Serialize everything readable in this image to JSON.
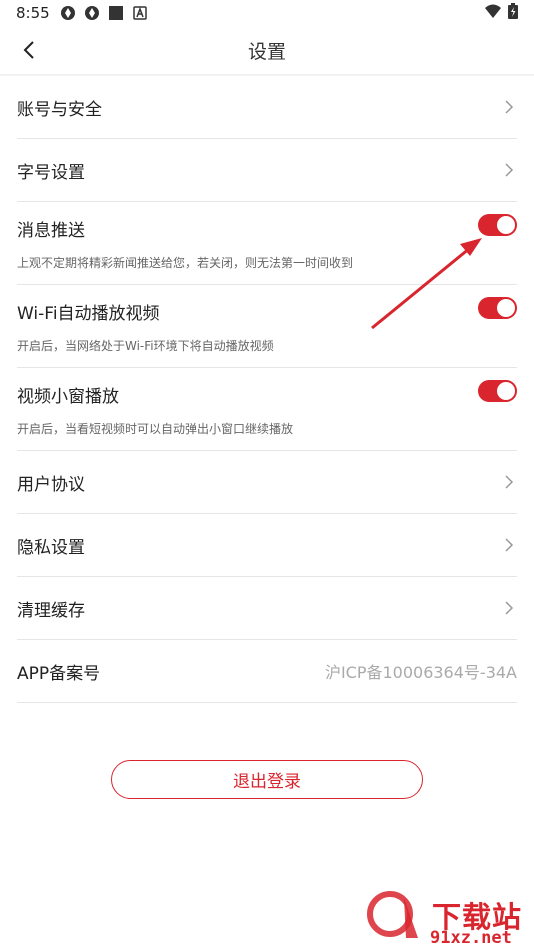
{
  "status_bar": {
    "time": "8:55",
    "left_icons": [
      "app-icon-1",
      "app-icon-2",
      "square-icon",
      "a-icon"
    ],
    "right_icons": [
      "wifi-icon",
      "battery-icon"
    ]
  },
  "header": {
    "title": "设置",
    "back_icon": "chevron-left-icon"
  },
  "settings": {
    "account_security": {
      "label": "账号与安全"
    },
    "font_size": {
      "label": "字号设置"
    },
    "push": {
      "label": "消息推送",
      "desc": "上观不定期将精彩新闻推送给您，若关闭，则无法第一时间收到",
      "enabled": true
    },
    "wifi_autoplay": {
      "label": "Wi-Fi自动播放视频",
      "desc": "开启后，当网络处于Wi-Fi环境下将自动播放视频",
      "enabled": true
    },
    "mini_window": {
      "label": "视频小窗播放",
      "desc": "开启后，当看短视频时可以自动弹出小窗口继续播放",
      "enabled": true
    },
    "user_agreement": {
      "label": "用户协议"
    },
    "privacy": {
      "label": "隐私设置"
    },
    "clear_cache": {
      "label": "清理缓存"
    },
    "icp": {
      "label": "APP备案号",
      "value": "沪ICP备10006364号-34A"
    }
  },
  "logout": {
    "label": "退出登录"
  },
  "watermark": {
    "brand": "下载站",
    "url": "91xz.net"
  },
  "colors": {
    "accent": "#d9252d"
  }
}
